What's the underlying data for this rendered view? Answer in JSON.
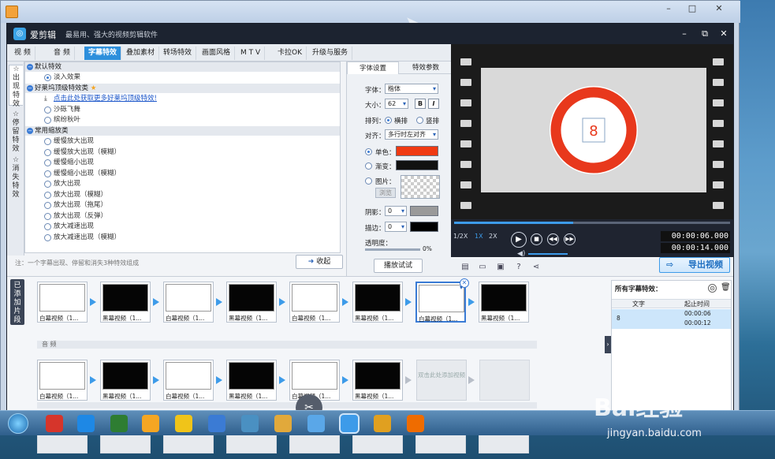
{
  "app": {
    "name": "爱剪辑",
    "slogan": "最易用、强大的视频剪辑软件"
  },
  "tabs": [
    "视 频",
    "音 频",
    "字幕特效",
    "叠加素材",
    "转场特效",
    "画面风格",
    "M T V",
    "卡拉OK",
    "升级与服务"
  ],
  "active_tab": "字幕特效",
  "side_tabs": [
    "出现特效",
    "停留特效",
    "消失特效"
  ],
  "effect_list": {
    "groups": [
      {
        "title": "默认特效",
        "items": [
          "淡入效果"
        ]
      },
      {
        "title": "好莱坞顶级特效类",
        "link": "点击此处获取更多好莱坞顶级特效!",
        "items": [
          "沙砾飞舞",
          "缤纷秋叶"
        ]
      },
      {
        "title": "常用缩放类",
        "items": [
          "缓慢放大出现",
          "缓慢放大出现（模糊）",
          "缓慢缩小出现",
          "缓慢缩小出现（模糊）",
          "放大出现",
          "放大出现（模糊）",
          "放大出现（拖尾）",
          "放大出现（反弹）",
          "放大减速出现",
          "放大减速出现（模糊）"
        ]
      }
    ]
  },
  "hint": "注：一个字幕出现、停留和消失3种特效组成",
  "collapse_button": "收起",
  "settings": {
    "tabs": [
      "字体设置",
      "特效参数"
    ],
    "font_label": "字体：",
    "font_value": "楷体",
    "size_label": "大小：",
    "size_value": "62",
    "bold": "B",
    "italic": "I",
    "layout_label": "排列：",
    "layout_h": "横排",
    "layout_v": "竖排",
    "align_label": "对齐：",
    "align_value": "多行时左对齐",
    "single_color": "单色：",
    "gradient": "渐变：",
    "image": "图片：",
    "browse": "浏览",
    "shadow_label": "阴影：",
    "shadow_value": "0",
    "stroke_label": "描边：",
    "stroke_value": "0",
    "opacity_label": "透明度：",
    "opacity_value": "0%",
    "colors": {
      "single": "#f03a12",
      "gradient": "#111111",
      "shadow": "#9a9a9a",
      "stroke": "#000000"
    }
  },
  "preview_button": "播放试试",
  "player": {
    "sign_number": "8",
    "speeds": [
      "1/2X",
      "1X",
      "2X"
    ],
    "time_current": "00:00:06.000",
    "time_total": "00:00:14.000",
    "progress": 0.43
  },
  "export_button": "导出视频",
  "timeline": {
    "added_tab": "已添加片段",
    "audio_label": "音 频",
    "video_clips": [
      {
        "caption": "白幕视频（1...",
        "tone": "white"
      },
      {
        "caption": "黑幕视频（1...",
        "tone": "black"
      },
      {
        "caption": "白幕视频（1...",
        "tone": "white"
      },
      {
        "caption": "黑幕视频（1...",
        "tone": "black"
      },
      {
        "caption": "白幕视频（1...",
        "tone": "white"
      },
      {
        "caption": "黑幕视频（1...",
        "tone": "black"
      },
      {
        "caption": "白幕视频（1...",
        "tone": "white"
      },
      {
        "caption": "黑幕视频（1...",
        "tone": "black"
      }
    ],
    "row2_clips": [
      {
        "caption": "白幕视频（1...",
        "tone": "white"
      },
      {
        "caption": "黑幕视频（1...",
        "tone": "black"
      },
      {
        "caption": "白幕视频（1...",
        "tone": "white"
      },
      {
        "caption": "黑幕视频（1...",
        "tone": "black"
      },
      {
        "caption": "白幕视频（1...",
        "tone": "white"
      },
      {
        "caption": "黑幕视频（1...",
        "tone": "black"
      }
    ],
    "add_video_hint": "双击此处添加视频"
  },
  "effects_panel": {
    "title": "所有字幕特效：",
    "col_text": "文字",
    "col_time": "起止时间",
    "row_text": "8",
    "row_start": "00:00:06",
    "row_end": "00:00:12"
  },
  "taskbar_icons": [
    "start-orb",
    "jiang-icon",
    "ie-icon",
    "chrome-icon",
    "video-player-icon",
    "folder-note-icon",
    "ie-blue-icon",
    "network-icon",
    "explorer-icon",
    "pinwheel-icon",
    "aijianji-icon",
    "paint-icon",
    "firefox-icon"
  ],
  "watermark": {
    "brand": "Bai经验",
    "url": "jingyan.baidu.com"
  }
}
